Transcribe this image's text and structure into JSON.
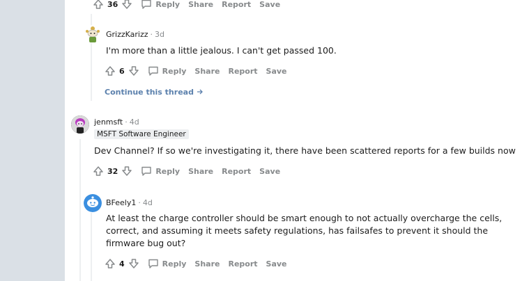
{
  "comments": [
    {
      "score": "36",
      "actions": {
        "reply": "Reply",
        "share": "Share",
        "report": "Report",
        "save": "Save"
      }
    },
    {
      "author": "GrizzKarizz",
      "time": "3d",
      "body": "I'm more than a little jealous. I can't get passed 100.",
      "score": "6",
      "actions": {
        "reply": "Reply",
        "share": "Share",
        "report": "Report",
        "save": "Save"
      },
      "continue_label": "Continue this thread"
    },
    {
      "author": "jenmsft",
      "time": "4d",
      "flair": "MSFT Software Engineer",
      "body": "Dev Channel? If so we're investigating it, there have been scattered reports for a few builds now",
      "score": "32",
      "actions": {
        "reply": "Reply",
        "share": "Share",
        "report": "Report",
        "save": "Save"
      }
    },
    {
      "author": "BFeely1",
      "time": "4d",
      "body": "At least the charge controller should be smart enough to not actually overcharge the cells, correct, and assuming it meets safety regulations, has failsafes to prevent it should the firmware bug out?",
      "score": "4",
      "actions": {
        "reply": "Reply",
        "share": "Share",
        "report": "Report",
        "save": "Save"
      }
    }
  ],
  "separator": "·",
  "icons": {
    "upvote": "upvote-arrow-icon",
    "downvote": "downvote-arrow-icon",
    "reply": "speech-bubble-icon",
    "continue": "arrow-right-icon"
  }
}
